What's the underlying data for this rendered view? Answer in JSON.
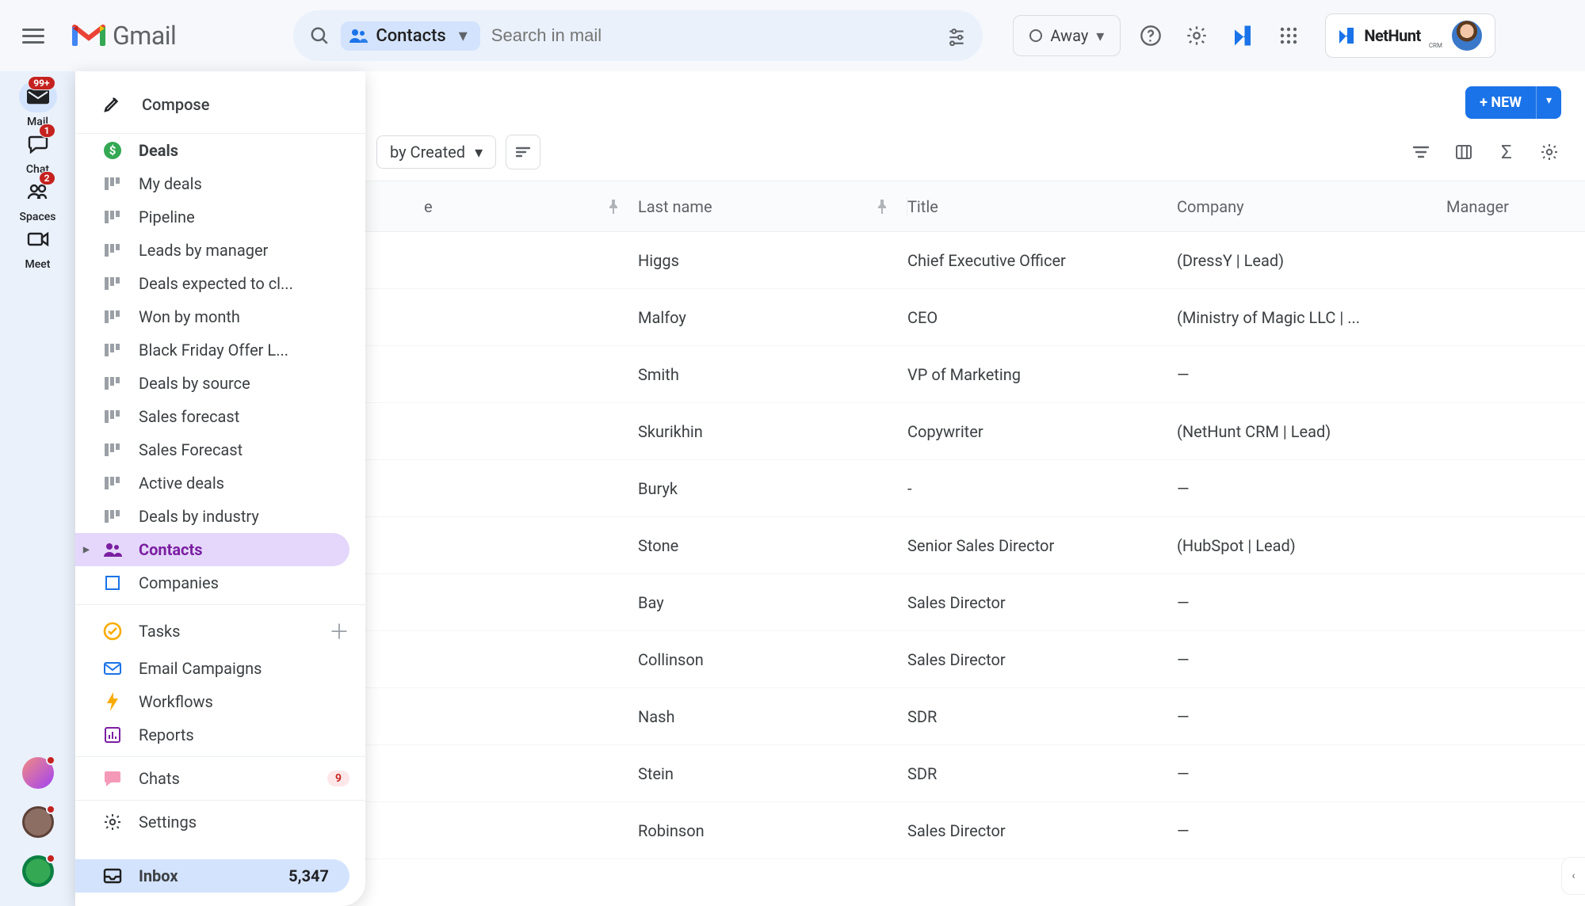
{
  "header": {
    "brand": "Gmail",
    "search_chip": "Contacts",
    "search_placeholder": "Search in mail",
    "status_label": "Away",
    "nethunt_label": "NetHunt",
    "nethunt_sup": "CRM"
  },
  "rail": {
    "items": [
      {
        "label": "Mail",
        "badge": "99+",
        "active": true
      },
      {
        "label": "Chat",
        "badge": "1"
      },
      {
        "label": "Spaces",
        "badge": "2"
      },
      {
        "label": "Meet"
      }
    ]
  },
  "sidebar": {
    "compose": "Compose",
    "deals": {
      "header": "Deals",
      "children": [
        "My deals",
        "Pipeline",
        "Leads by manager",
        "Deals expected to cl...",
        "Won by month",
        "Black Friday Offer L...",
        "Deals by source",
        "Sales forecast",
        "Sales Forecast",
        "Active deals",
        "Deals by industry"
      ]
    },
    "contacts": "Contacts",
    "companies": "Companies",
    "tasks": "Tasks",
    "email_campaigns": "Email Campaigns",
    "workflows": "Workflows",
    "reports": "Reports",
    "chats": {
      "label": "Chats",
      "badge": "9"
    },
    "settings": "Settings",
    "inbox": {
      "label": "Inbox",
      "count": "5,347"
    }
  },
  "toolbar": {
    "sort_label": "by Created",
    "new_label": "+ NEW"
  },
  "columns": {
    "first_fragment": "e",
    "last": "Last name",
    "title": "Title",
    "company": "Company",
    "manager": "Manager"
  },
  "rows": [
    {
      "last": "Higgs",
      "title": "Chief Executive Officer",
      "company": "(DressY | Lead)"
    },
    {
      "last": "Malfoy",
      "title": "CEO",
      "company": "(Ministry of Magic LLC | ..."
    },
    {
      "last": "Smith",
      "title": "VP of Marketing",
      "company": "—"
    },
    {
      "last": "Skurikhin",
      "title": "Copywriter",
      "company": "(NetHunt CRM | Lead)"
    },
    {
      "last": "Buryk",
      "title": "-",
      "company": "—"
    },
    {
      "last": "Stone",
      "title": "Senior Sales Director",
      "company": "(HubSpot | Lead)"
    },
    {
      "last": "Bay",
      "title": "Sales Director",
      "company": "—"
    },
    {
      "last": "Collinson",
      "title": "Sales Director",
      "company": "—"
    },
    {
      "last": "Nash",
      "title": "SDR",
      "company": "—"
    },
    {
      "last": "Stein",
      "title": "SDR",
      "company": "—"
    },
    {
      "last": "Robinson",
      "title": "Sales Director",
      "company": "—"
    }
  ]
}
